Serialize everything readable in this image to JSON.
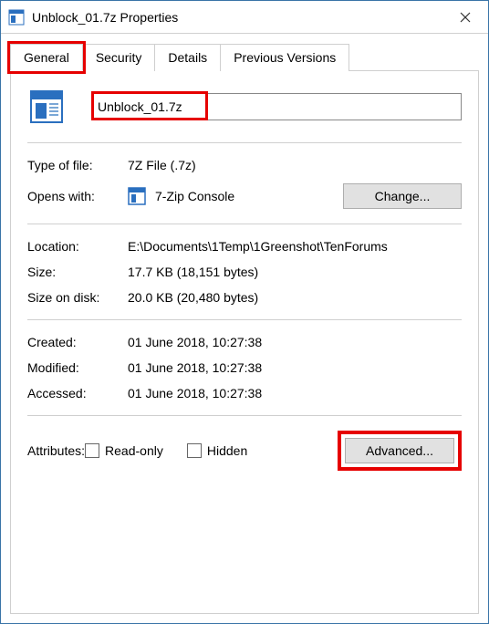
{
  "window": {
    "title": "Unblock_01.7z Properties"
  },
  "tabs": {
    "general": "General",
    "security": "Security",
    "details": "Details",
    "previous": "Previous Versions",
    "active": "general"
  },
  "file": {
    "name": "Unblock_01.7z",
    "type_label": "Type of file:",
    "type_value": "7Z File (.7z)",
    "opens_label": "Opens with:",
    "opens_app": "7-Zip Console",
    "change_label": "Change...",
    "location_label": "Location:",
    "location_value": "E:\\Documents\\1Temp\\1Greenshot\\TenForums",
    "size_label": "Size:",
    "size_value": "17.7 KB (18,151 bytes)",
    "size_on_disk_label": "Size on disk:",
    "size_on_disk_value": "20.0 KB (20,480 bytes)",
    "created_label": "Created:",
    "created_value": "01 June 2018, 10:27:38",
    "modified_label": "Modified:",
    "modified_value": "01 June 2018, 10:27:38",
    "accessed_label": "Accessed:",
    "accessed_value": "01 June 2018, 10:27:38",
    "attributes_label": "Attributes:",
    "readonly_label": "Read-only",
    "hidden_label": "Hidden",
    "advanced_label": "Advanced...",
    "readonly_checked": false,
    "hidden_checked": false
  }
}
